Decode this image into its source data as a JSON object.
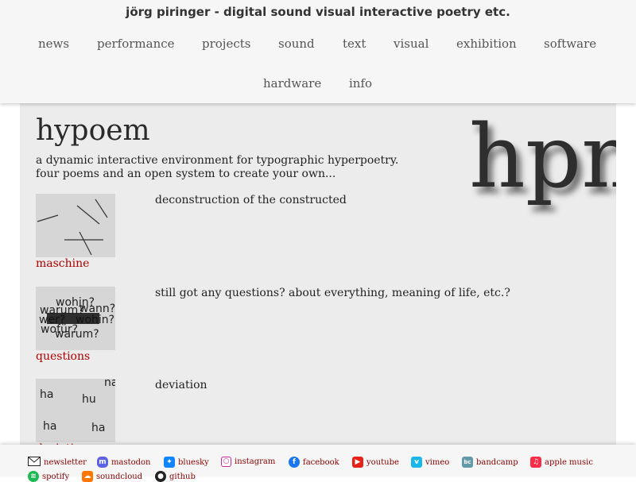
{
  "header": {
    "title": "jörg piringer - digital sound visual interactive poetry etc.",
    "nav": [
      "news",
      "performance",
      "projects",
      "sound",
      "text",
      "visual",
      "exhibition",
      "software",
      "hardware",
      "info"
    ]
  },
  "main": {
    "title": "hypoem",
    "intro": [
      "a dynamic interactive environment for typographic hyperpoetry.",
      "four poems and an open system to create your own..."
    ],
    "logo_text": "hpm",
    "poems": [
      {
        "link": "maschine",
        "description": "deconstruction of the constructed"
      },
      {
        "link": "questions",
        "description": "still got any questions? about everything, meaning of life, etc.?"
      },
      {
        "link": "deviation",
        "description": "deviation"
      }
    ],
    "thumb_questions_words": [
      "wohin?",
      "warum?",
      "wann?",
      "wer?",
      "wofür?"
    ],
    "thumb_deviation_words": [
      "ha",
      "hu",
      "ha",
      "ha",
      "na"
    ]
  },
  "footer": {
    "links": [
      {
        "label": "newsletter",
        "icon": "envelope-icon",
        "color": "#ffffff"
      },
      {
        "label": "mastodon",
        "icon": "mastodon-icon",
        "color": "#5b62e6"
      },
      {
        "label": "bluesky",
        "icon": "bluesky-icon",
        "color": "#1185fe"
      },
      {
        "label": "instagram",
        "icon": "instagram-icon",
        "color": "#d6249f"
      },
      {
        "label": "facebook",
        "icon": "facebook-icon",
        "color": "#1877f2"
      },
      {
        "label": "youtube",
        "icon": "youtube-icon",
        "color": "#e62117"
      },
      {
        "label": "vimeo",
        "icon": "vimeo-icon",
        "color": "#1ab7ea"
      },
      {
        "label": "bandcamp",
        "icon": "bandcamp-icon",
        "color": "#629aa9"
      },
      {
        "label": "apple music",
        "icon": "apple-music-icon",
        "color": "#fa2d48"
      },
      {
        "label": "spotify",
        "icon": "spotify-icon",
        "color": "#1db954"
      },
      {
        "label": "soundcloud",
        "icon": "soundcloud-icon",
        "color": "#ff7700"
      },
      {
        "label": "github",
        "icon": "github-icon",
        "color": "#222222"
      }
    ]
  }
}
